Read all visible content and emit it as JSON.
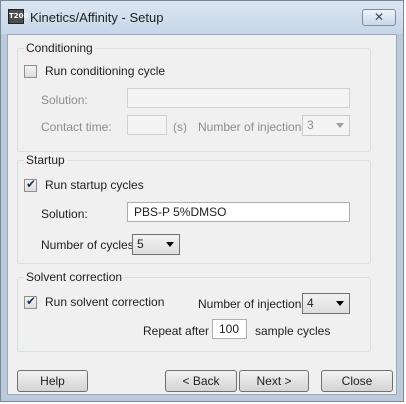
{
  "window": {
    "title": "Kinetics/Affinity - Setup",
    "app_icon_text": "T200",
    "close_label": "✕"
  },
  "conditioning": {
    "group_title": "Conditioning",
    "checkbox_label": "Run conditioning cycle",
    "checked": false,
    "solution_label": "Solution:",
    "solution_value": "",
    "contact_time_label": "Contact time:",
    "contact_time_value": "",
    "contact_time_unit": "(s)",
    "injections_label": "Number of injections:",
    "injections_value": "3"
  },
  "startup": {
    "group_title": "Startup",
    "checkbox_label": "Run startup cycles",
    "checked": true,
    "solution_label": "Solution:",
    "solution_value": "PBS-P 5%DMSO",
    "cycles_label": "Number of cycles:",
    "cycles_value": "5"
  },
  "solvent_correction": {
    "group_title": "Solvent correction",
    "checkbox_label": "Run solvent correction",
    "checked": true,
    "injections_label": "Number of injections:",
    "injections_value": "4",
    "repeat_label": "Repeat after",
    "repeat_value": "100",
    "repeat_suffix": "sample cycles"
  },
  "buttons": {
    "help": "Help",
    "back": "< Back",
    "next": "Next >",
    "close": "Close"
  }
}
